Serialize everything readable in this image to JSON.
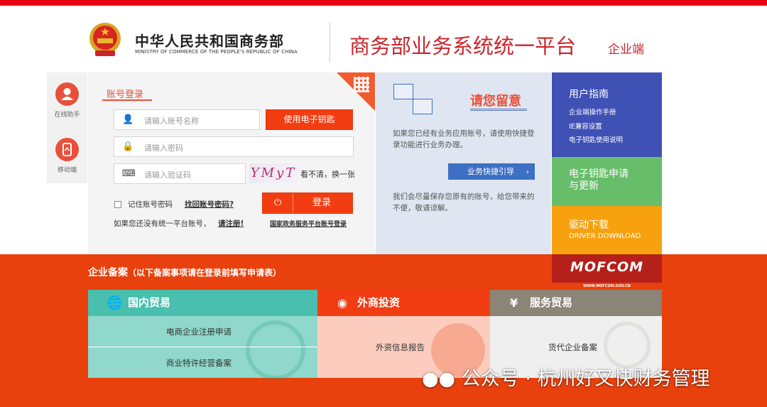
{
  "header": {
    "ministry_cn": "中华人民共和国商务部",
    "ministry_en": "MINISTRY OF COMMERCE OF THE PEOPLE'S REPUBLIC OF CHINA",
    "platform_title": "商务部业务系统统一平台",
    "platform_sub": "企业端"
  },
  "sidebar": {
    "items": [
      {
        "label": "在线助手",
        "icon": "user-icon"
      },
      {
        "label": "移动端",
        "icon": "mobile-icon"
      }
    ]
  },
  "login": {
    "tab": "账号登录",
    "account_placeholder": "请输入账号名称",
    "ukey_button": "使用电子钥匙",
    "password_placeholder": "请输入密码",
    "captcha_placeholder": "请输入验证码",
    "captcha_text": "YMyT",
    "captcha_refresh": "看不清，换一张",
    "remember": "记住账号密码",
    "forgot": "找回账号密码?",
    "login_button": "登录",
    "register_prompt": "如果您还没有统一平台账号，",
    "register_link": "请注册!",
    "gov_login": "国家政务服务平台账号登录"
  },
  "notice": {
    "title": "请您留意",
    "text1": "如果您已经有业务应用账号，请使用快捷登录功能进行业务办理。",
    "quick_button": "业务快捷引导",
    "text2": "我们会尽量保存您原有的账号，给您带来的不便，敬请谅解。"
  },
  "guide": {
    "title": "用户指南",
    "items": [
      "企业端操作手册",
      "IE兼容设置",
      "电子钥匙使用说明"
    ]
  },
  "ukey": {
    "title_line1": "电子钥匙申请",
    "title_line2": "与更新"
  },
  "driver": {
    "title": "驱动下载",
    "subtitle": "DRIVER DOWNLOAD"
  },
  "mofcom": {
    "logo": "MOFCOM",
    "url": "WWW.MOFCOM.GOV.CN"
  },
  "records": {
    "title": "企业备案",
    "subtitle": "（以下备案事项请在登录前填写申请表）",
    "columns": [
      {
        "head": "国内贸易",
        "icon": "globe-icon",
        "items": [
          "电商企业注册申请",
          "商业特许经营备案"
        ]
      },
      {
        "head": "外商投资",
        "icon": "coins-icon",
        "items": [
          "外资信息报告"
        ]
      },
      {
        "head": "服务贸易",
        "icon": "yuan-hand-icon",
        "items": [
          "货代企业备案"
        ]
      }
    ]
  },
  "watermark": "公众号 · 杭州好又快财务管理",
  "colors": {
    "brand_red": "#e60012",
    "band": "#e8410d",
    "teal": "#49bfad",
    "red_orange": "#f23d12",
    "gray": "#8b8577",
    "blue": "#3f51b5",
    "green": "#67bd6a",
    "orange": "#f7a10f"
  }
}
